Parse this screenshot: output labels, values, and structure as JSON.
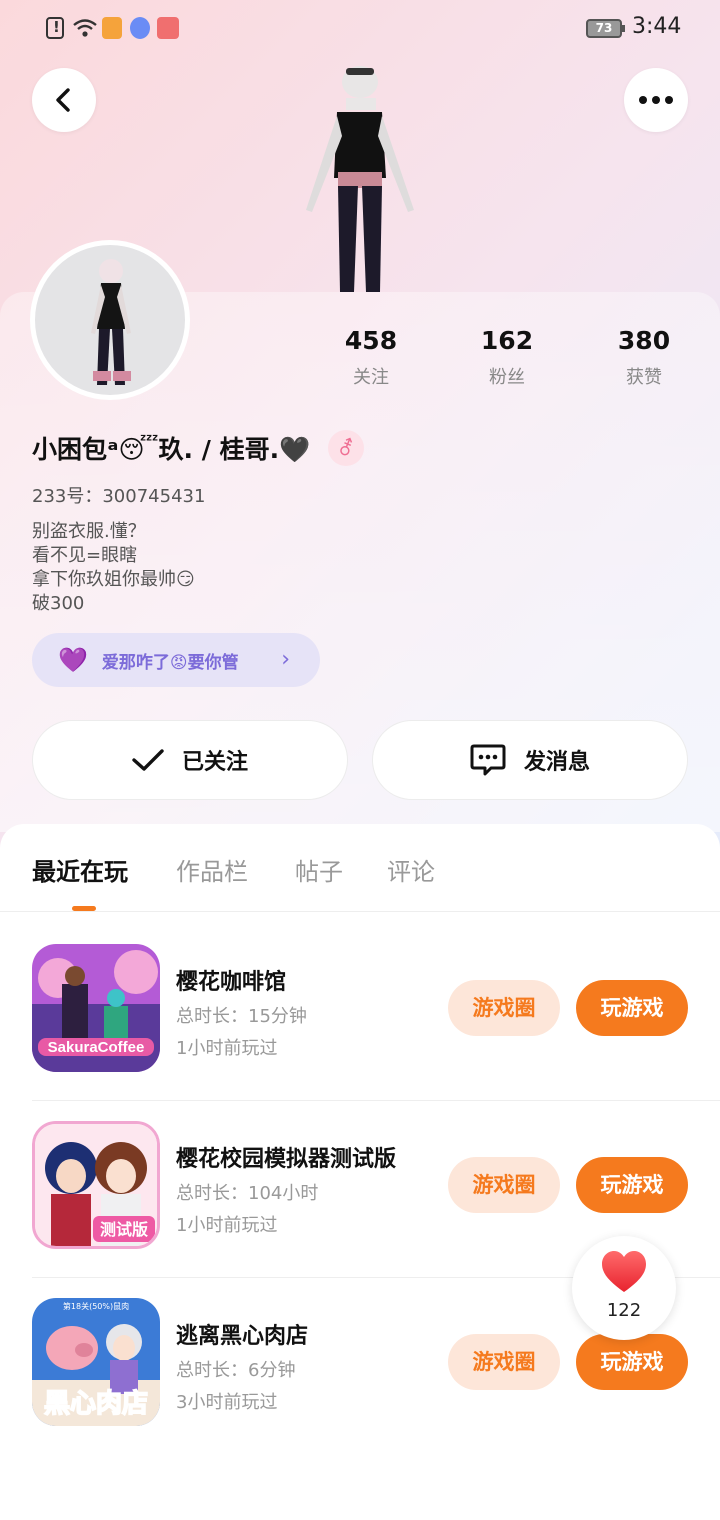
{
  "status_bar": {
    "battery": "73",
    "time": "3:44"
  },
  "stats": [
    {
      "value": "458",
      "label": "关注"
    },
    {
      "value": "162",
      "label": "粉丝"
    },
    {
      "value": "380",
      "label": "获赞"
    }
  ],
  "profile": {
    "nickname": "小困包ᵃ😴玖. / 桂哥.🖤",
    "gender_symbol": "⚦",
    "uid": "233号：300745431",
    "bio": [
      "别盗衣服.懂？",
      "看不见=眼瞎",
      "拿下你玖姐你最帅😏",
      "破300"
    ]
  },
  "club": {
    "label": "爱那咋了😡要你管"
  },
  "actions": {
    "follow_label": "已关注",
    "message_label": "发消息"
  },
  "tabs": [
    {
      "label": "最近在玩",
      "active": true
    },
    {
      "label": "作品栏",
      "active": false
    },
    {
      "label": "帖子",
      "active": false
    },
    {
      "label": "评论",
      "active": false
    }
  ],
  "games": [
    {
      "title": "樱花咖啡馆",
      "duration": "总时长：15分钟",
      "last_played": "1小时前玩过",
      "circle_label": "游戏圈",
      "play_label": "玩游戏",
      "icon_text": "SakuraCoffee"
    },
    {
      "title": "樱花校园模拟器测试版",
      "duration": "总时长：104小时",
      "last_played": "1小时前玩过",
      "circle_label": "游戏圈",
      "play_label": "玩游戏",
      "icon_text": "测试版"
    },
    {
      "title": "逃离黑心肉店",
      "duration": "总时长：6分钟",
      "last_played": "3小时前玩过",
      "circle_label": "游戏圈",
      "play_label": "玩游戏",
      "icon_text": "黑心肉店",
      "icon_banner": "第18关(50%)鼠肉"
    }
  ],
  "like": {
    "count": "122"
  },
  "colors": {
    "accent": "#f57a1e",
    "accent_soft": "#fde6d9",
    "club": "#7c6bd9"
  }
}
